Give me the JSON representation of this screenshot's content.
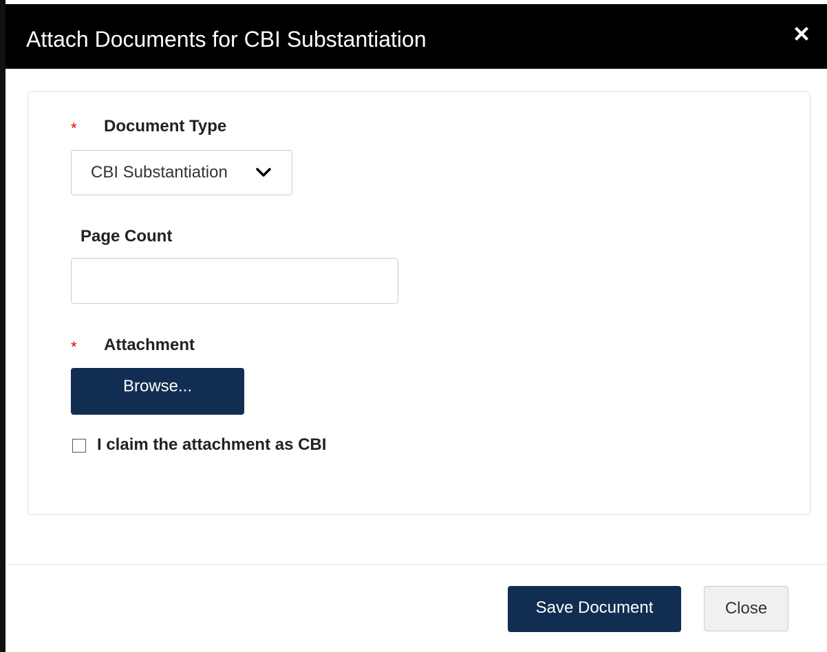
{
  "dialog": {
    "title": "Attach Documents for CBI Substantiation"
  },
  "form": {
    "document_type": {
      "required_marker": "*",
      "label": "Document Type",
      "selected_value": "CBI Substantiation"
    },
    "page_count": {
      "label": "Page Count",
      "value": ""
    },
    "attachment": {
      "required_marker": "*",
      "label": "Attachment",
      "browse_label": "Browse..."
    },
    "cbi_claim": {
      "label": "I claim the attachment as CBI",
      "checked": false
    }
  },
  "footer": {
    "save_label": "Save Document",
    "close_label": "Close"
  },
  "colors": {
    "header_bg": "#000000",
    "primary_button": "#112e52",
    "required": "#e00000"
  }
}
